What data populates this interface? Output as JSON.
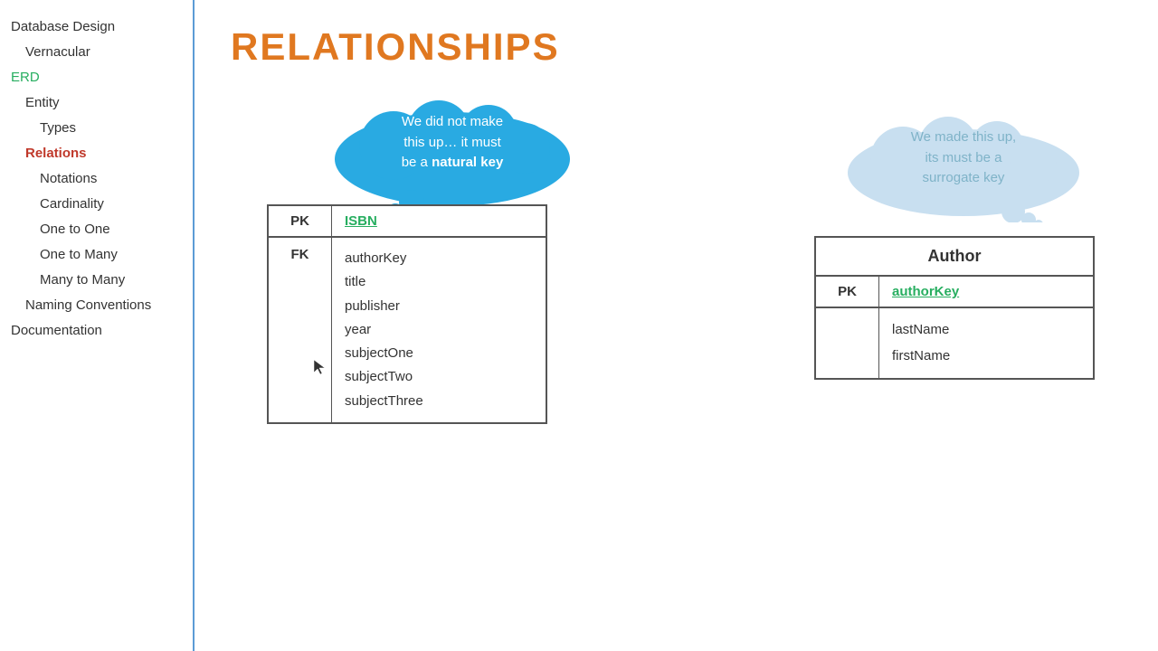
{
  "sidebar": {
    "items": [
      {
        "id": "database-design",
        "label": "Database Design",
        "indent": 0,
        "style": "default"
      },
      {
        "id": "vernacular",
        "label": "Vernacular",
        "indent": 1,
        "style": "default"
      },
      {
        "id": "erd",
        "label": "ERD",
        "indent": 0,
        "style": "green"
      },
      {
        "id": "entity",
        "label": "Entity",
        "indent": 1,
        "style": "default"
      },
      {
        "id": "types",
        "label": "Types",
        "indent": 2,
        "style": "default"
      },
      {
        "id": "relations",
        "label": "Relations",
        "indent": 1,
        "style": "active"
      },
      {
        "id": "notations",
        "label": "Notations",
        "indent": 2,
        "style": "default"
      },
      {
        "id": "cardinality",
        "label": "Cardinality",
        "indent": 2,
        "style": "default"
      },
      {
        "id": "one-to-one",
        "label": "One to One",
        "indent": 3,
        "style": "default"
      },
      {
        "id": "one-to-many",
        "label": "One to Many",
        "indent": 3,
        "style": "default"
      },
      {
        "id": "many-to-many",
        "label": "Many to Many",
        "indent": 3,
        "style": "default"
      },
      {
        "id": "naming-conventions",
        "label": "Naming Conventions",
        "indent": 1,
        "style": "default"
      },
      {
        "id": "documentation",
        "label": "Documentation",
        "indent": 0,
        "style": "default"
      }
    ]
  },
  "page": {
    "title": "RELATIONSHIPS"
  },
  "cloud_left": {
    "text_line1": "We did not make",
    "text_line2": "this up… it must",
    "text_line3_prefix": "be a ",
    "text_line3_bold": "natural key"
  },
  "cloud_right": {
    "text_line1": "We made this up,",
    "text_line2": "its must be a",
    "text_line3": "surrogate key"
  },
  "table_left": {
    "pk_label": "PK",
    "pk_value": "ISBN",
    "fk_label": "FK",
    "fields": [
      "authorKey",
      "title",
      "publisher",
      "year",
      "subjectOne",
      "subjectTwo",
      "subjectThree"
    ]
  },
  "table_right": {
    "title": "Author",
    "pk_label": "PK",
    "pk_value": "authorKey",
    "fields": [
      "lastName",
      "firstName"
    ]
  }
}
